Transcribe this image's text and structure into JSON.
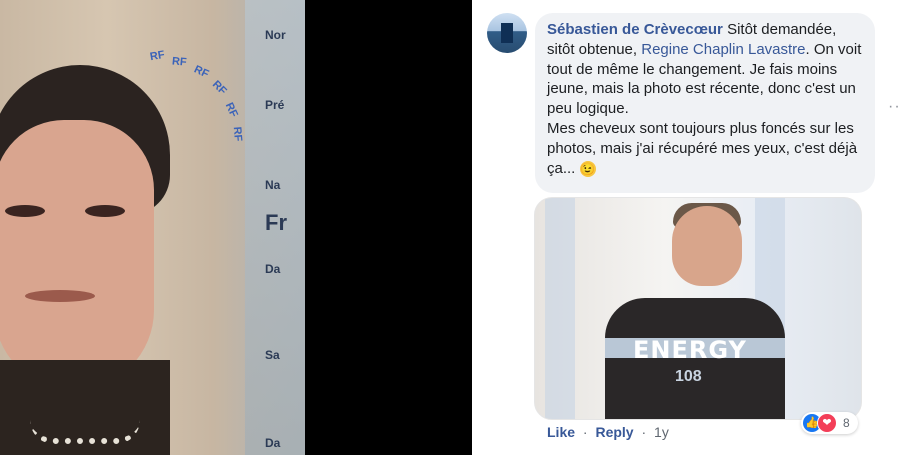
{
  "id_card": {
    "arc_text": [
      "RF",
      "RF",
      "RF",
      "RF",
      "RF",
      "RF"
    ],
    "side_labels": [
      "Nor",
      "Pré",
      "Na",
      "Fr",
      "Da",
      "Sa",
      "Da"
    ]
  },
  "comment": {
    "author": "Sébastien de Crèvecœur",
    "text_part1": " Sitôt demandée, sitôt obtenue, ",
    "mention": "Regine Chaplin Lavastre",
    "text_part2": ". On voit tout de même le changement. Je fais moins jeune, mais la photo est récente, donc c'est un peu logique.",
    "text_part3": "Mes cheveux sont toujours plus foncés sur les photos, mais j'ai récupéré mes yeux, c'est déjà ça... ",
    "emoji_glyph": "😉"
  },
  "attachment": {
    "shirt_text": "ENERGY",
    "shirt_num": "108"
  },
  "actions": {
    "like": "Like",
    "reply": "Reply",
    "time": "1y",
    "sep": "·"
  },
  "reactions": {
    "count": "8",
    "like_icon": "👍",
    "love_icon": "❤"
  },
  "more_dots": "···"
}
